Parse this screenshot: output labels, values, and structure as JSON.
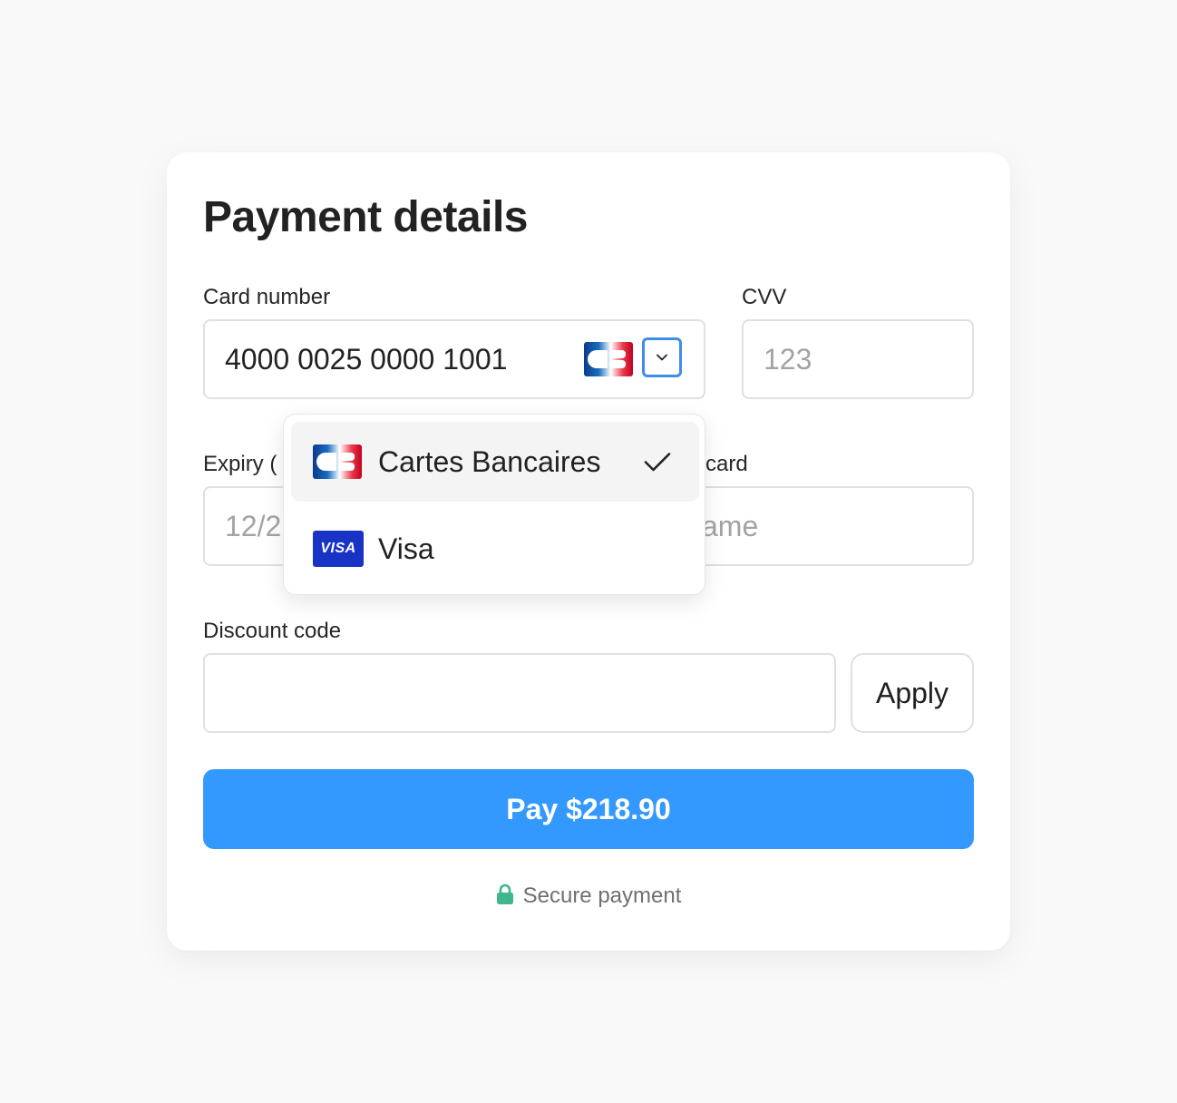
{
  "page": {
    "title": "Payment details"
  },
  "card_number": {
    "label": "Card number",
    "value": "4000 0025 0000 1001",
    "selected_brand_icon": "cartes-bancaires-logo"
  },
  "cvv": {
    "label": "CVV",
    "placeholder": "123"
  },
  "expiry": {
    "label_visible": "Expiry (",
    "placeholder_visible": "12/2"
  },
  "name_on_card": {
    "label_visible": "card",
    "placeholder_visible": "ame"
  },
  "brand_dropdown": {
    "options": [
      {
        "label": "Cartes Bancaires",
        "icon": "cartes-bancaires-logo",
        "selected": true
      },
      {
        "label": "Visa",
        "icon": "visa-logo",
        "logo_text": "VISA",
        "selected": false
      }
    ]
  },
  "discount": {
    "label": "Discount code",
    "value": "",
    "apply_label": "Apply"
  },
  "pay_button": {
    "label": "Pay $218.90"
  },
  "footer": {
    "secure_text": "Secure payment",
    "icon": "lock-icon"
  },
  "colors": {
    "page_background": "#f9f9f9",
    "card_background": "#ffffff",
    "primary": "#3399ff",
    "focus_ring": "#3d8ee8",
    "lock_green": "#3fb68b",
    "visa_blue": "#1a33c7"
  }
}
